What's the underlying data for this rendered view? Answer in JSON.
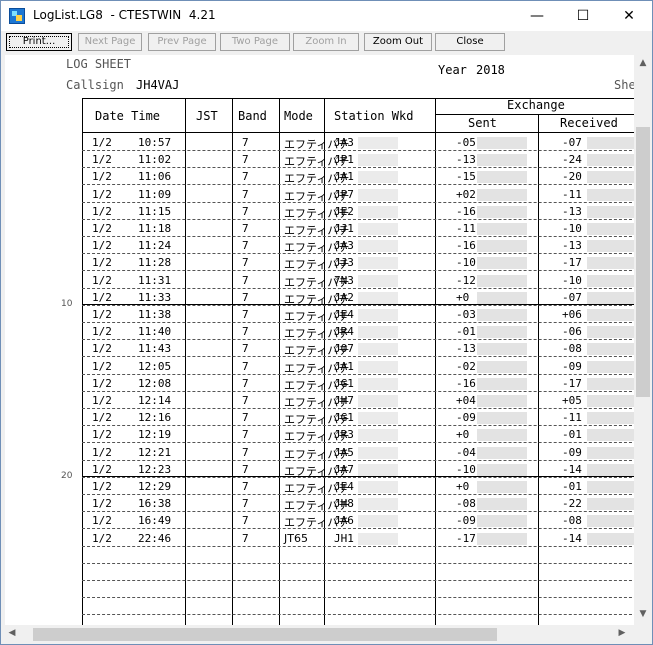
{
  "window": {
    "title": "LogList.LG8  - CTESTWIN  4.21",
    "minimize": "—",
    "maximize": "☐",
    "close": "✕"
  },
  "toolbar": {
    "print": "Print...",
    "next_page": "Next Page",
    "prev_page": "Prev Page",
    "two_page": "Two Page",
    "zoom_in": "Zoom In",
    "zoom_out": "Zoom Out",
    "close": "Close"
  },
  "sheet": {
    "title": "LOG SHEET",
    "year_label": "Year",
    "year_value": "2018",
    "callsign_label": "Callsign",
    "callsign_value": "JH4VAJ",
    "sheet_label": "She"
  },
  "columns": {
    "date_time": "Date Time",
    "jst": "JST",
    "band": "Band",
    "mode": "Mode",
    "station": "Station Wkd",
    "exchange": "Exchange",
    "sent": "Sent",
    "received": "Received"
  },
  "line_numbers": [
    "10",
    "20"
  ],
  "rows": [
    {
      "date": "1/2",
      "time": "10:57",
      "band": "7",
      "mode": "エフティパチ",
      "station": "JA3",
      "sent": "-05",
      "recv": "-07"
    },
    {
      "date": "1/2",
      "time": "11:02",
      "band": "7",
      "mode": "エフティパチ",
      "station": "JP1",
      "sent": "-13",
      "recv": "-24"
    },
    {
      "date": "1/2",
      "time": "11:06",
      "band": "7",
      "mode": "エフティパチ",
      "station": "JA1",
      "sent": "-15",
      "recv": "-20"
    },
    {
      "date": "1/2",
      "time": "11:09",
      "band": "7",
      "mode": "エフティパチ",
      "station": "JP7",
      "sent": "+02",
      "recv": "-11"
    },
    {
      "date": "1/2",
      "time": "11:15",
      "band": "7",
      "mode": "エフティパチ",
      "station": "JE2",
      "sent": "-16",
      "recv": "-13"
    },
    {
      "date": "1/2",
      "time": "11:18",
      "band": "7",
      "mode": "エフティパチ",
      "station": "JJ1",
      "sent": "-11",
      "recv": "-10"
    },
    {
      "date": "1/2",
      "time": "11:24",
      "band": "7",
      "mode": "エフティパチ",
      "station": "JA3",
      "sent": "-16",
      "recv": "-13"
    },
    {
      "date": "1/2",
      "time": "11:28",
      "band": "7",
      "mode": "エフティパチ",
      "station": "JJ3",
      "sent": "-10",
      "recv": "-17"
    },
    {
      "date": "1/2",
      "time": "11:31",
      "band": "7",
      "mode": "エフティパチ",
      "station": "7N3",
      "sent": "-12",
      "recv": "-10"
    },
    {
      "date": "1/2",
      "time": "11:33",
      "band": "7",
      "mode": "エフティパチ",
      "station": "JA2",
      "sent": "+0",
      "recv": "-07"
    },
    {
      "date": "1/2",
      "time": "11:38",
      "band": "7",
      "mode": "エフティパチ",
      "station": "JE4",
      "sent": "-03",
      "recv": "+06"
    },
    {
      "date": "1/2",
      "time": "11:40",
      "band": "7",
      "mode": "エフティパチ",
      "station": "JR4",
      "sent": "-01",
      "recv": "-06"
    },
    {
      "date": "1/2",
      "time": "11:43",
      "band": "7",
      "mode": "エフティパチ",
      "station": "JO7",
      "sent": "-13",
      "recv": "-08"
    },
    {
      "date": "1/2",
      "time": "12:05",
      "band": "7",
      "mode": "エフティパチ",
      "station": "JA1",
      "sent": "-02",
      "recv": "-09"
    },
    {
      "date": "1/2",
      "time": "12:08",
      "band": "7",
      "mode": "エフティパチ",
      "station": "JG1",
      "sent": "-16",
      "recv": "-17"
    },
    {
      "date": "1/2",
      "time": "12:14",
      "band": "7",
      "mode": "エフティパチ",
      "station": "JH7",
      "sent": "+04",
      "recv": "+05"
    },
    {
      "date": "1/2",
      "time": "12:16",
      "band": "7",
      "mode": "エフティパチ",
      "station": "JG1",
      "sent": "-09",
      "recv": "-11"
    },
    {
      "date": "1/2",
      "time": "12:19",
      "band": "7",
      "mode": "エフティパチ",
      "station": "JR3",
      "sent": "+0",
      "recv": "-01"
    },
    {
      "date": "1/2",
      "time": "12:21",
      "band": "7",
      "mode": "エフティパチ",
      "station": "JA5",
      "sent": "-04",
      "recv": "-09"
    },
    {
      "date": "1/2",
      "time": "12:23",
      "band": "7",
      "mode": "エフティパチ",
      "station": "JA7",
      "sent": "-10",
      "recv": "-14"
    },
    {
      "date": "1/2",
      "time": "12:29",
      "band": "7",
      "mode": "エフティパチ",
      "station": "JE4",
      "sent": "+0",
      "recv": "-01"
    },
    {
      "date": "1/2",
      "time": "16:38",
      "band": "7",
      "mode": "エフティパチ",
      "station": "JH8",
      "sent": "-08",
      "recv": "-22"
    },
    {
      "date": "1/2",
      "time": "16:49",
      "band": "7",
      "mode": "エフティパチ",
      "station": "JA6",
      "sent": "-09",
      "recv": "-08"
    },
    {
      "date": "1/2",
      "time": "22:46",
      "band": "7",
      "mode": "JT65",
      "station": "JH1",
      "sent": "-17",
      "recv": "-14"
    }
  ],
  "scrollbar": {
    "up": "▲",
    "down": "▼",
    "left": "◀",
    "right": "▶"
  }
}
